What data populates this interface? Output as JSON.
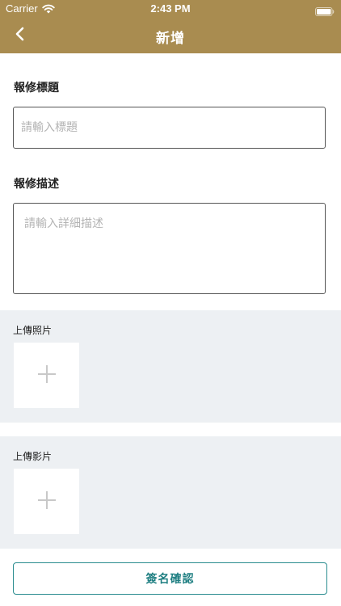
{
  "status_bar": {
    "carrier": "Carrier",
    "time": "2:43 PM",
    "wifi_icon": "wifi-icon",
    "battery_icon": "battery-full-icon"
  },
  "nav": {
    "back_icon": "chevron-left-icon",
    "title": "新增"
  },
  "form": {
    "title_label": "報修標題",
    "title_placeholder": "請輸入標題",
    "title_value": "",
    "description_label": "報修描述",
    "description_placeholder": "請輸入詳細描述",
    "description_value": ""
  },
  "uploads": {
    "photo_label": "上傳照片",
    "video_label": "上傳影片",
    "add_icon": "plus-icon"
  },
  "actions": {
    "confirm_label": "簽名確認"
  },
  "colors": {
    "header_bg": "#a98c50",
    "section_bg": "#edf0f3",
    "accent": "#2a8c8f"
  }
}
